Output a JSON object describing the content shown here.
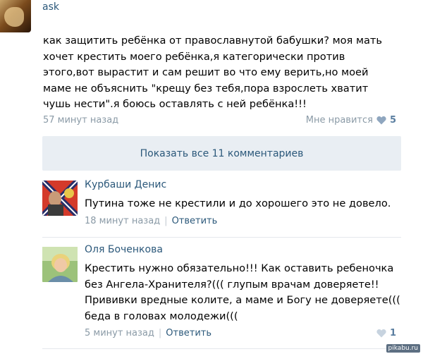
{
  "post": {
    "author": "ask",
    "text": "как защитить ребёнка от православнутой бабушки? моя мать\nхочет крестить моего ребёнка,я категорически против\nэтого,вот вырастит и сам решит во что ему верить,но моей\nмаме не объяснить \"крещу без тебя,пора взрослеть хватит\nчушь нести\".я боюсь оставлять с ней ребёнка!!!",
    "time": "57 минут назад",
    "like_label": "Мне нравится",
    "like_count": "5"
  },
  "show_all_label": "Показать все 11 комментариев",
  "comments": [
    {
      "name": "Курбаши Денис",
      "text": "Путина тоже не крестили и до хорошего это не довело.",
      "time": "18 минут назад",
      "reply": "Ответить"
    },
    {
      "name": "Оля Боченкова",
      "text": "Крестить нужно обязательно!!! Как оставить ребеночка\nбез Ангела-Хранителя?((( глупым врачам доверяете!!\nПрививки вредные колите, а маме и Богу не доверяете(((\nбеда в головах молодежи(((",
      "time": "5 минут назад",
      "reply": "Ответить",
      "like_count": "1"
    }
  ],
  "separator": "|",
  "watermark": "pikabu.ru",
  "colors": {
    "link": "#2b587a",
    "meta": "#8a9aa6",
    "button_bg": "#e9eef3",
    "heart": "#8fa6bf"
  },
  "icons": {
    "like": "heart-icon"
  }
}
